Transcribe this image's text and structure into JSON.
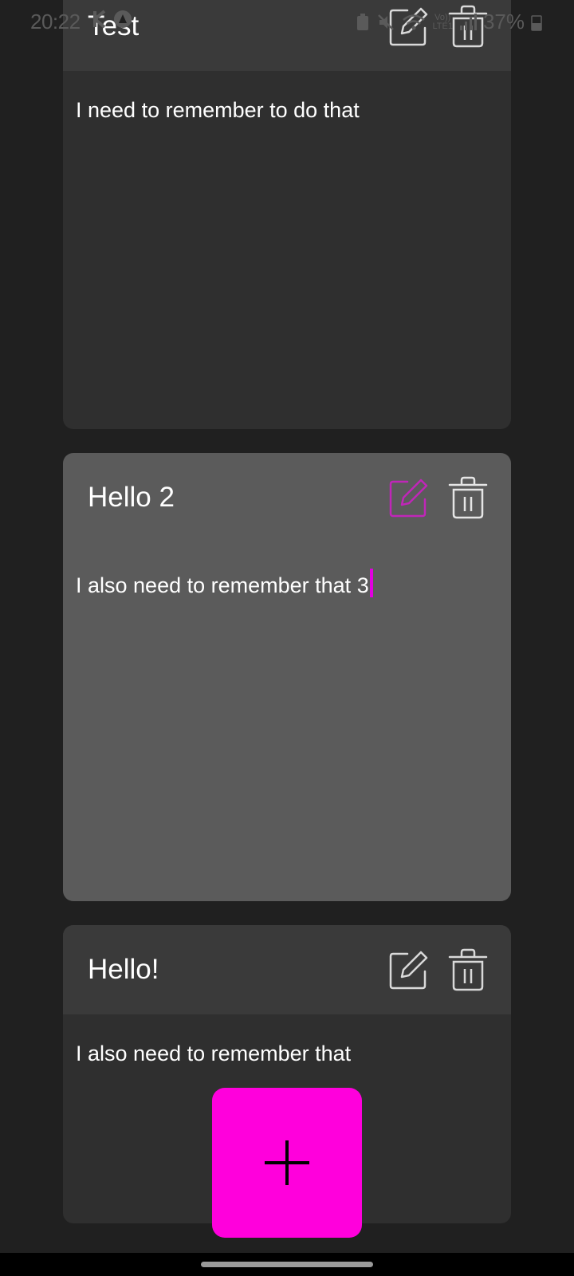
{
  "status_bar": {
    "time": "20:22",
    "network_label": "Vo))\nLTE1",
    "battery": "37%"
  },
  "notes": [
    {
      "title": "Test",
      "body": "I need to remember to do that",
      "edit_icon": "edit-icon",
      "delete_icon": "trash-icon"
    },
    {
      "title": "Hello 2",
      "body": "I also need to remember that 3",
      "edit_icon": "edit-icon",
      "delete_icon": "trash-icon",
      "editing": true
    },
    {
      "title": "Hello!",
      "body": "I also need to remember that",
      "edit_icon": "edit-icon",
      "delete_icon": "trash-icon"
    }
  ],
  "fab": {
    "icon": "plus-icon"
  },
  "colors": {
    "background": "#202020",
    "card": "#2f2f2f",
    "card_header": "#3a3a3a",
    "card_active": "#5b5b5b",
    "accent": "#ff00dc",
    "accent_edit": "#c026b8"
  }
}
